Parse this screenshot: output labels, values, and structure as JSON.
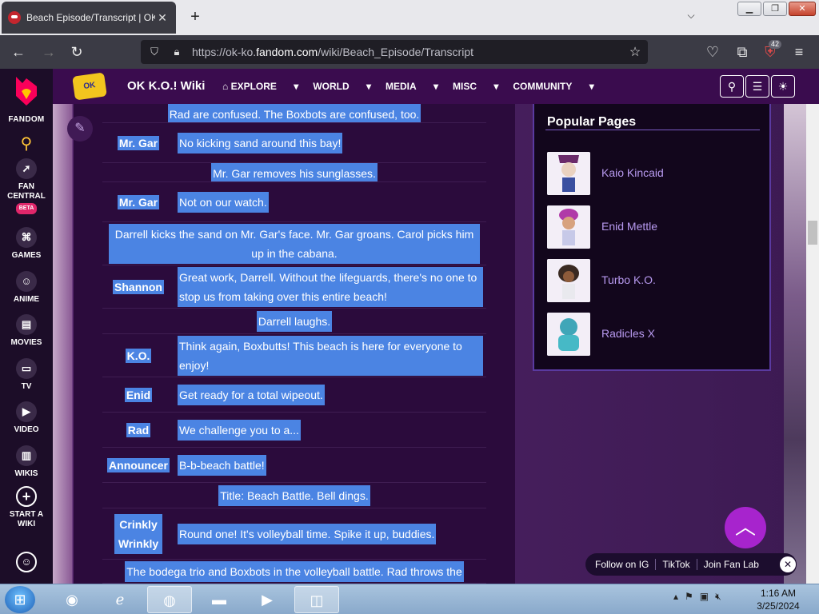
{
  "browser": {
    "tab_title": "Beach Episode/Transcript | OK K.O.! Wiki",
    "url_prefix": "https://ok-ko.",
    "url_domain": "fandom.com",
    "url_path": "/wiki/Beach_Episode/Transcript",
    "new_tab_label": "+",
    "extension_badge": "42"
  },
  "rail": {
    "brand": "FANDOM",
    "items": [
      {
        "label": "FAN CENTRAL",
        "badge": "BETA"
      },
      {
        "label": "GAMES"
      },
      {
        "label": "ANIME"
      },
      {
        "label": "MOVIES"
      },
      {
        "label": "TV"
      },
      {
        "label": "VIDEO"
      },
      {
        "label": "WIKIS"
      },
      {
        "label": "START A WIKI"
      }
    ]
  },
  "wiki": {
    "name": "OK K.O.! Wiki",
    "logo_text": "OK K.O.!",
    "nav": [
      "EXPLORE",
      "WORLD",
      "MEDIA",
      "MISC",
      "COMMUNITY"
    ]
  },
  "transcript": {
    "lead": "Rad are confused. The Boxbots are confused, too.",
    "rows": [
      {
        "speaker": "Mr. Gar",
        "line": "No kicking sand around this bay!"
      },
      {
        "action": "Mr. Gar removes his sunglasses."
      },
      {
        "speaker": "Mr. Gar",
        "line": "Not on our watch."
      },
      {
        "action": "Darrell kicks the sand on Mr. Gar's face. Mr. Gar groans. Carol picks him up in the cabana."
      },
      {
        "speaker": "Shannon",
        "line": "Great work, Darrell. Without the lifeguards, there's no one to stop us from taking over this entire beach!"
      },
      {
        "action": "Darrell laughs."
      },
      {
        "speaker": "K.O.",
        "line": "Think again, Boxbutts! This beach is here for everyone to enjoy!"
      },
      {
        "speaker": "Enid",
        "line": "Get ready for a total wipeout."
      },
      {
        "speaker": "Rad",
        "line": "We challenge you to a..."
      },
      {
        "speaker": "Announcer",
        "line": "B-b-beach battle!"
      },
      {
        "action": "Title: Beach Battle. Bell dings."
      },
      {
        "speaker": "Crinkly Wrinkly",
        "line": "Round one! It's volleyball time. Spike it up, buddies."
      },
      {
        "action": "The bodega trio and Boxbots in the volleyball battle. Rad throws the"
      }
    ]
  },
  "popular": {
    "title": "Popular Pages",
    "items": [
      "Kaio Kincaid",
      "Enid Mettle",
      "Turbo K.O.",
      "Radicles X"
    ]
  },
  "fanbar": {
    "items": [
      "Follow on IG",
      "TikTok",
      "Join Fan Lab"
    ]
  },
  "taskbar": {
    "time": "1:16 AM",
    "date": "3/25/2024"
  },
  "colors": {
    "selection": "#4b84e3",
    "wiki_header": "#3a0c4e",
    "accent": "#a724cd"
  }
}
